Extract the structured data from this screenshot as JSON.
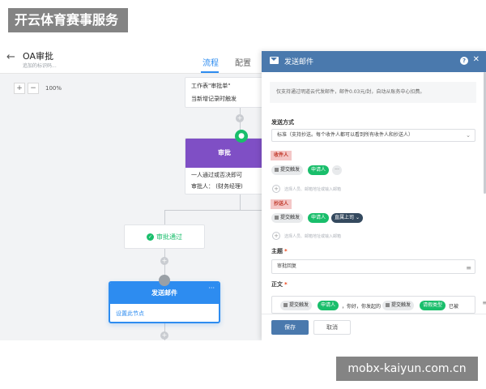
{
  "watermark_top": "开云体育赛事服务",
  "watermark_bottom": "mobx-kaiyun.com.cn",
  "header": {
    "title": "OA审批",
    "subtitle": "追加的标识码...",
    "tabs": [
      {
        "label": "流程"
      },
      {
        "label": "配置"
      }
    ]
  },
  "zoom": {
    "minus": "−",
    "plus": "+",
    "level": "100%"
  },
  "canvas": {
    "top_card": {
      "line1": "工作表\"审批单\"",
      "line2": "当新增记录时触发"
    },
    "approve_card": {
      "title": "审批",
      "row1": "一人通过或否决即可",
      "row2": "审批人：  (财务经理)"
    },
    "pass_card": {
      "label": "审批通过"
    },
    "mail_card": {
      "title": "发送邮件",
      "body": "设置此节点"
    }
  },
  "panel": {
    "title": "发送邮件",
    "notice": "仅支持通过明道云代发邮件，邮件0.03元/封，自动从账务中心扣费。",
    "send_mode": {
      "label": "发送方式",
      "value": "标准（支持抄送。每个收件人都可以看到所有收件人和抄送人）"
    },
    "recipients": {
      "label": "收件人",
      "chip_source": "提交触发",
      "chip_person": "申请人",
      "more": "···",
      "add_hint": "选择人员、邮箱地址或输入邮箱"
    },
    "cc": {
      "label": "抄送人",
      "chip_source": "提交触发",
      "chip_person": "申请人",
      "chip_role": "直属上司",
      "add_hint": "选择人员、邮箱地址或输入邮箱"
    },
    "subject": {
      "label": "主题",
      "value": "审批回复"
    },
    "body": {
      "label": "正文",
      "chip_source_1": "提交触发",
      "chip_person": "申请人",
      "text_mid": "，你好，你发起的",
      "chip_source_2": "提交触发",
      "chip_type": "请假类型",
      "text_end": "已被"
    },
    "buttons": {
      "save": "保存",
      "cancel": "取消"
    }
  }
}
